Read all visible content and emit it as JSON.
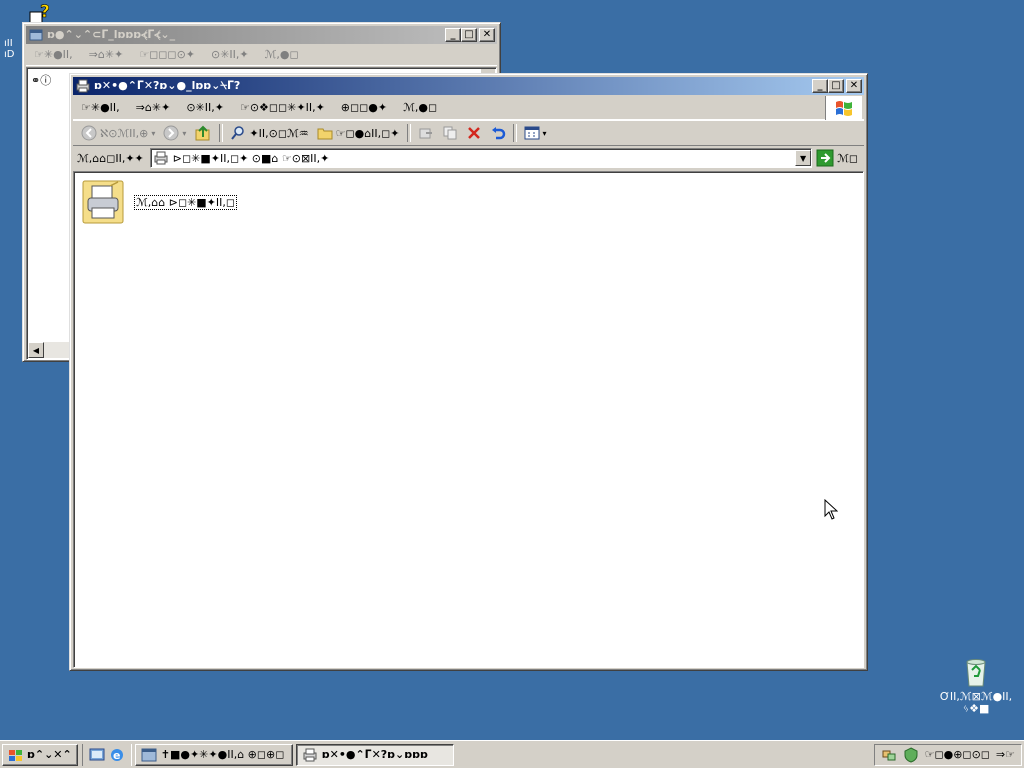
{
  "desktop": {
    "background_color": "#3a6ea5",
    "help_icon_name": "help-question-icon",
    "left_partial_label_1": "ıII",
    "left_partial_label_2": "ıD",
    "recycle_bin": {
      "icon": "recycle-bin-icon",
      "label_line1": "ƠII,ℳ⊠ℳ●II,",
      "label_line2": "ᛃ❖■"
    }
  },
  "back_window": {
    "title": "ɒ●⌃⌄⌃⊂ᒥ_lɒɒɒ⦓ᒥ⦓⌄_",
    "menu": [
      "☞✳●II,",
      "⇒⌂✳✦",
      "☞◻◻◻⊙✦",
      "⊙✳II,✦",
      "ℳ,●◻"
    ],
    "content_label": "⚭ⓘ",
    "caption_buttons": [
      "_",
      "□",
      "✕"
    ]
  },
  "main_window": {
    "title": "ɒ✕•●⌃ᒥ✕?ɒ⌄●_lɒɒ⌄⍀ᒥ?",
    "menu": [
      "☞✳●II,",
      "⇒⌂✳✦",
      "⊙✳II,✦",
      "☞⊙❖◻◻✳✦II,✦",
      "⊕◻◻●✦",
      "ℳ,●◻"
    ],
    "toolbar": {
      "back_label": "ℵ⊙ℳII,⊕",
      "search_label": "✦II,⊙◻ℳ♒",
      "folders_label": "☞◻●⌂II,◻✦"
    },
    "address": {
      "label": "ℳ,⌂⌂◻II,✦✦",
      "value": "⊳◻✳■✦II,◻✦  ⊙■⌂  ☞⊙⊠II,✦",
      "go_label": "ℳ◻"
    },
    "items": [
      {
        "icon": "printer-folder-icon",
        "label": "ℳ,⌂⌂  ⊳◻✳■✦II,◻"
      }
    ],
    "caption_buttons": [
      "_",
      "□",
      "✕"
    ]
  },
  "taskbar": {
    "start_label": "ɒ⌃⌄✕⌃",
    "tasks": [
      {
        "label": "✝■●✦✳✦●II,⌂  ⊕◻⊕◻",
        "icon": "explorer-window-icon",
        "pressed": false
      },
      {
        "label": "ɒ✕•●⌃ᒥ✕?ɒ⌄ɒɒɒ",
        "icon": "printers-window-icon",
        "pressed": true
      }
    ],
    "tray_text_1": "☞◻●⊕◻⊙◻",
    "tray_text_2": "⇒☞"
  }
}
